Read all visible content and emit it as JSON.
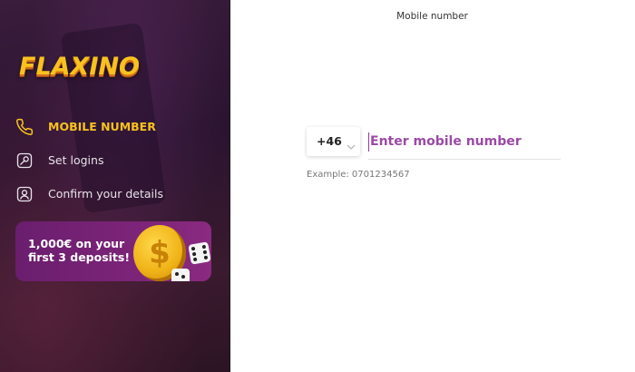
{
  "brand": {
    "logo_text": "FLAXINO"
  },
  "steps": [
    {
      "label": "MOBILE NUMBER",
      "icon": "phone-icon",
      "active": true
    },
    {
      "label": "Set logins",
      "icon": "key-icon",
      "active": false
    },
    {
      "label": "Confirm your details",
      "icon": "user-icon",
      "active": false
    }
  ],
  "promo": {
    "text": "1,000€ on your first 3 deposits!"
  },
  "form": {
    "title": "Mobile number",
    "country_code": "+46",
    "phone_placeholder": "Enter mobile number",
    "phone_value": "",
    "hint": "Example: 0701234567"
  },
  "colors": {
    "accent": "#f8c21e",
    "placeholder": "#9b4aa6",
    "promo_bg": "#7c2478"
  }
}
